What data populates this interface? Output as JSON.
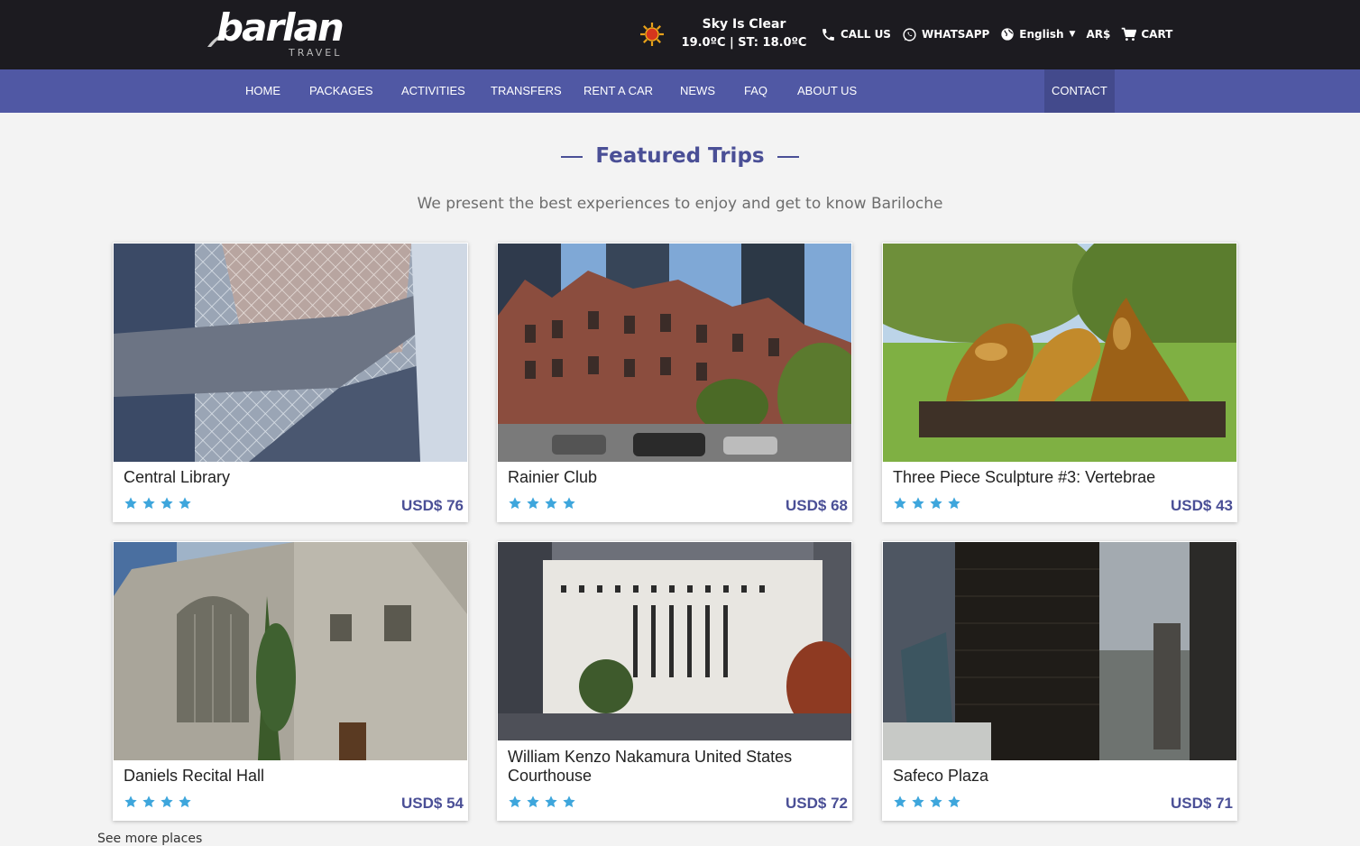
{
  "brand": {
    "logo_main": "barlan",
    "logo_sub": "TRAVEL"
  },
  "weather": {
    "condition": "Sky Is Clear",
    "temps": "19.0ºC | ST: 18.0ºC",
    "icon": "sun-icon"
  },
  "toplinks": {
    "call": "CALL US",
    "whatsapp": "WHATSAPP",
    "language": "English",
    "currency": "AR$",
    "cart": "CART"
  },
  "nav": {
    "items": [
      "HOME",
      "PACKAGES",
      "ACTIVITIES",
      "TRANSFERS",
      "RENT A CAR",
      "NEWS",
      "FAQ",
      "ABOUT US"
    ],
    "contact": "CONTACT"
  },
  "section": {
    "title": "Featured Trips",
    "subtitle": "We present the best experiences to enjoy and get to know Bariloche"
  },
  "cards": [
    {
      "title": "Central Library",
      "rating": 4,
      "price": "USD$ 76"
    },
    {
      "title": "Rainier Club",
      "rating": 4,
      "price": "USD$ 68"
    },
    {
      "title": "Three Piece Sculpture #3: Vertebrae",
      "rating": 4,
      "price": "USD$ 43"
    },
    {
      "title": "Daniels Recital Hall",
      "rating": 4,
      "price": "USD$ 54"
    },
    {
      "title": "William Kenzo Nakamura United States Courthouse",
      "rating": 4,
      "price": "USD$ 72"
    },
    {
      "title": "Safeco Plaza",
      "rating": 4,
      "price": "USD$ 71"
    }
  ],
  "footer": {
    "see_more": "See more places"
  },
  "colors": {
    "topbar": "#1c1b20",
    "nav": "#5058a4",
    "accent": "#4a4f96",
    "star": "#3ea6dc"
  }
}
